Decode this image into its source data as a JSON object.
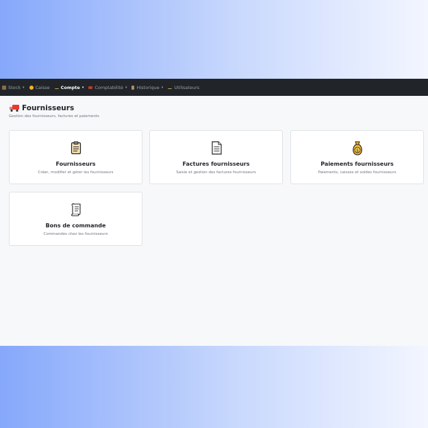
{
  "navbar": {
    "items": [
      {
        "label": "Stock",
        "icon": "box-icon",
        "dropdown": true,
        "active": false
      },
      {
        "label": "Caisse",
        "icon": "money-bag-icon",
        "dropdown": false,
        "active": false
      },
      {
        "label": "Compte",
        "icon": "user-icon",
        "dropdown": true,
        "active": true
      },
      {
        "label": "Comptabilité",
        "icon": "book-icon",
        "dropdown": true,
        "active": false
      },
      {
        "label": "Historique",
        "icon": "history-icon",
        "dropdown": true,
        "active": false
      },
      {
        "label": "Utilisateurs",
        "icon": "users-icon",
        "dropdown": false,
        "active": false
      }
    ],
    "caret": "▾"
  },
  "header": {
    "icon": "truck-icon",
    "title": "Fournisseurs",
    "subtitle": "Gestion des fournisseurs, factures et paiements"
  },
  "cards": [
    {
      "icon": "clipboard-icon",
      "title": "Fournisseurs",
      "description": "Créer, modifier et gérer les fournisseurs"
    },
    {
      "icon": "document-icon",
      "title": "Factures fournisseurs",
      "description": "Saisie et gestion des factures fournisseurs"
    },
    {
      "icon": "money-bag-icon",
      "title": "Paiements fournisseurs",
      "description": "Paiements, caisses et soldes fournisseurs"
    },
    {
      "icon": "scroll-icon",
      "title": "Bons de commande",
      "description": "Commandes chez les fournisseurs"
    }
  ],
  "colors": {
    "navbar_bg": "#212529",
    "page_bg": "#f7f8fa",
    "truck_red": "#e63b2e",
    "gold": "#f2b42a"
  }
}
